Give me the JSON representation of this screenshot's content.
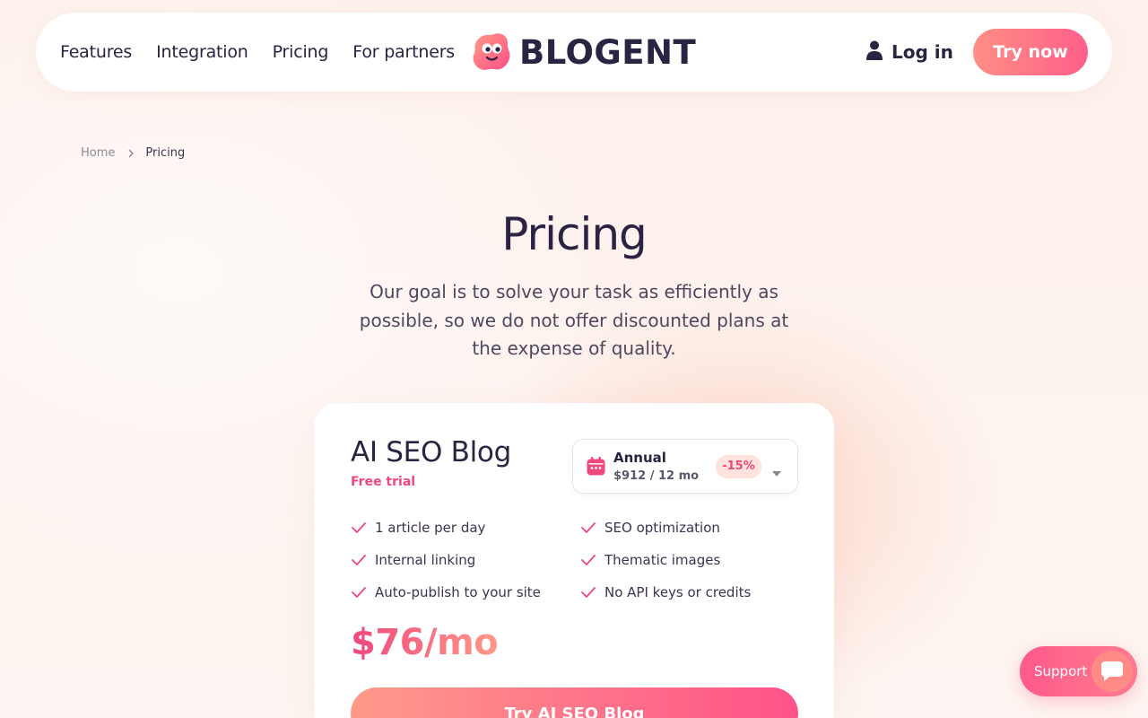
{
  "colors": {
    "accent_pink": "#f0477c",
    "accent_coral": "#ff8f84",
    "text_dark": "#2a2342",
    "background": "#fdf3ee"
  },
  "header": {
    "nav": [
      {
        "label": "Features"
      },
      {
        "label": "Integration"
      },
      {
        "label": "Pricing"
      },
      {
        "label": "For partners"
      }
    ],
    "logo_text": "BLOGENT",
    "login_label": "Log in",
    "login_icon": "user-icon",
    "cta_label": "Try now"
  },
  "breadcrumb": {
    "home": "Home",
    "current": "Pricing",
    "separator_icon": "chevron-right-icon"
  },
  "hero": {
    "title": "Pricing",
    "subtitle": "Our goal is to solve your task as efficiently as possible, so we do not offer discounted plans at the expense of quality."
  },
  "plan": {
    "name": "AI SEO Blog",
    "tag": "Free trial",
    "period": {
      "icon": "calendar-icon",
      "label": "Annual",
      "sublabel": "$912 / 12 mo",
      "discount": "-15%",
      "caret_icon": "caret-down-icon"
    },
    "features": [
      {
        "label": "1 article per day"
      },
      {
        "label": "SEO optimization"
      },
      {
        "label": "Internal linking"
      },
      {
        "label": "Thematic images"
      },
      {
        "label": "Auto-publish to your site"
      },
      {
        "label": "No API keys or credits"
      }
    ],
    "price": "$76/mo",
    "cta_label": "Try AI SEO Blog"
  },
  "support": {
    "label": "Support",
    "icon": "chat-bubble-icon"
  }
}
